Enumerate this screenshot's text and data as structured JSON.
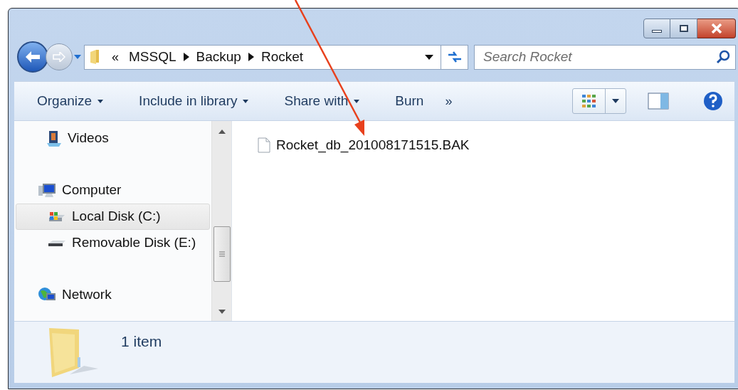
{
  "address_bar": {
    "overflow": "«",
    "crumbs": [
      "MSSQL",
      "Backup",
      "Rocket"
    ]
  },
  "search": {
    "placeholder": "Search Rocket"
  },
  "toolbar": {
    "items": [
      {
        "label": "Organize",
        "dropdown": true
      },
      {
        "label": "Include in library",
        "dropdown": true
      },
      {
        "label": "Share with",
        "dropdown": true
      },
      {
        "label": "Burn",
        "dropdown": false
      }
    ],
    "more": "»"
  },
  "sidebar": {
    "items": [
      {
        "label": "Videos",
        "kind": "videos",
        "selected": false
      },
      {
        "label": "Computer",
        "kind": "computer",
        "selected": false,
        "children": [
          {
            "label": "Local Disk (C:)",
            "kind": "disk",
            "selected": true
          },
          {
            "label": "Removable Disk (E:)",
            "kind": "removable",
            "selected": false
          }
        ]
      },
      {
        "label": "Network",
        "kind": "network",
        "selected": false
      }
    ]
  },
  "files": [
    {
      "name": "Rocket_db_201008171515.BAK"
    }
  ],
  "details": {
    "count": "1 item"
  }
}
